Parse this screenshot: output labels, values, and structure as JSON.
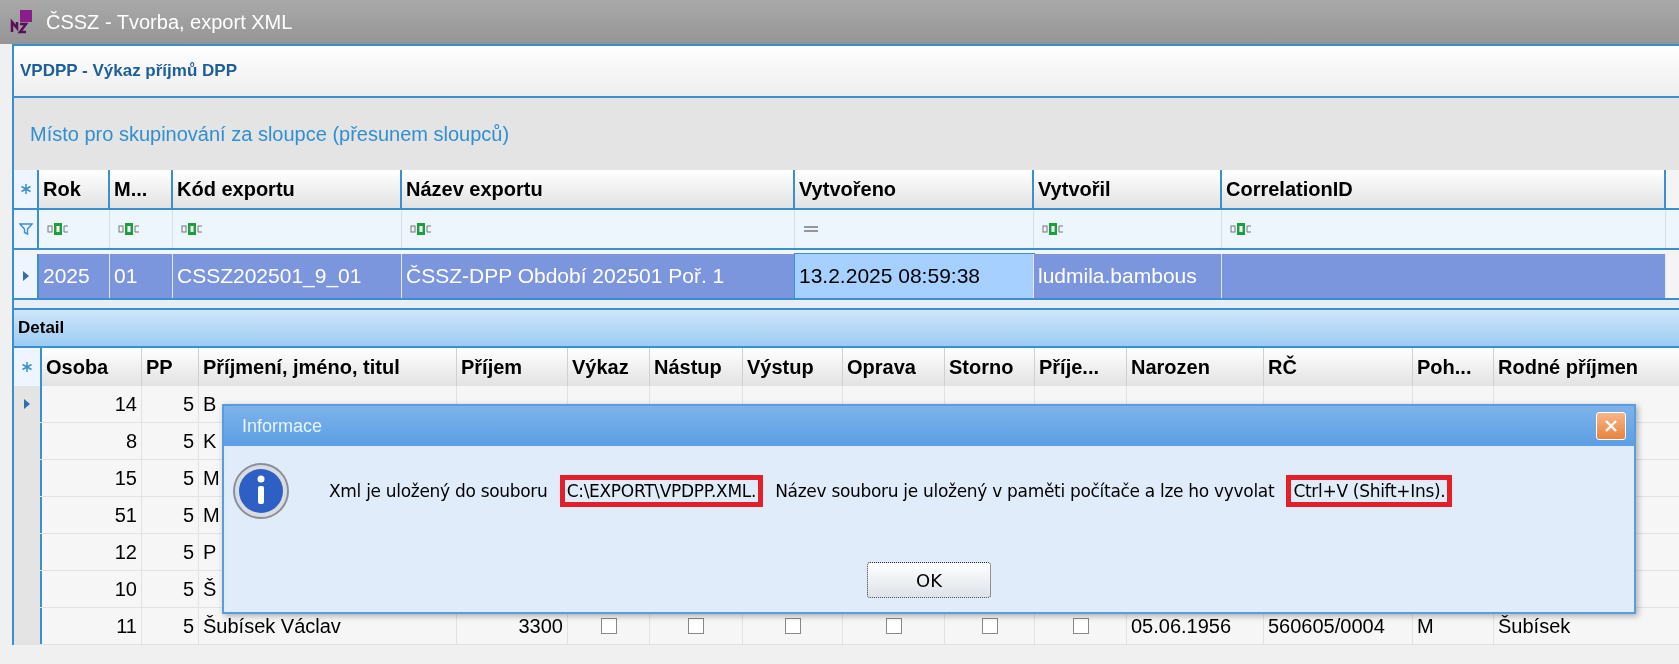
{
  "window": {
    "title": "ČSSZ - Tvorba, export XML"
  },
  "panel_title": "VPDPP - Výkaz příjmů DPP",
  "group_hint": "Místo pro skupinování za sloupce (přesunem sloupců)",
  "top_grid": {
    "columns": [
      {
        "label": "Rok",
        "kind": "text"
      },
      {
        "label": "M...",
        "kind": "text"
      },
      {
        "label": "Kód exportu",
        "kind": "text"
      },
      {
        "label": "Název exportu",
        "kind": "text"
      },
      {
        "label": "Vytvořeno",
        "kind": "equals"
      },
      {
        "label": "Vytvořil",
        "kind": "text"
      },
      {
        "label": "CorrelationID",
        "kind": "text"
      }
    ],
    "rows": [
      {
        "selected": true,
        "current": true,
        "cells": [
          {
            "text": "2025",
            "focused": false
          },
          {
            "text": "01",
            "focused": false
          },
          {
            "text": "CSSZ202501_9_01",
            "focused": false
          },
          {
            "text": "ČSSZ-DPP Období 202501 Poř. 1",
            "focused": false
          },
          {
            "text": "13.2.2025 08:59:38",
            "focused": true
          },
          {
            "text": "ludmila.bambous",
            "focused": false
          },
          {
            "focused": false
          }
        ]
      }
    ]
  },
  "detail": {
    "title": "Detail",
    "columns": [
      {
        "label": "Osoba",
        "kind": "number"
      },
      {
        "label": "PP",
        "kind": "number"
      },
      {
        "label": "Příjmení, jméno, titul",
        "kind": "text"
      },
      {
        "label": "Příjem",
        "kind": "number"
      },
      {
        "label": "Výkaz",
        "kind": "check"
      },
      {
        "label": "Nástup",
        "kind": "check"
      },
      {
        "label": "Výstup",
        "kind": "check"
      },
      {
        "label": "Oprava",
        "kind": "check"
      },
      {
        "label": "Storno",
        "kind": "check"
      },
      {
        "label": "Příje...",
        "kind": "check"
      },
      {
        "label": "Narozen",
        "kind": "text"
      },
      {
        "label": "RČ",
        "kind": "text"
      },
      {
        "label": "Poh...",
        "kind": "text"
      },
      {
        "label": "Rodné příjmen",
        "kind": "text"
      }
    ],
    "rows": [
      {
        "current": true,
        "cells": [
          "14",
          "5",
          "B"
        ]
      },
      {
        "current": false,
        "cells": [
          "8",
          "5",
          "K"
        ]
      },
      {
        "current": false,
        "cells": [
          "15",
          "5",
          "M"
        ]
      },
      {
        "current": false,
        "cells": [
          "51",
          "5",
          "M"
        ]
      },
      {
        "current": false,
        "cells": [
          "12",
          "5",
          "P"
        ]
      },
      {
        "current": false,
        "cells": [
          "10",
          "5",
          "Š"
        ]
      },
      {
        "current": false,
        "cells": [
          "11",
          "5",
          "Šubísek Václav",
          "3300",
          false,
          false,
          false,
          false,
          false,
          false,
          "05.06.1956",
          "560605/0004",
          "M",
          "Šubísek"
        ]
      }
    ]
  },
  "dialog": {
    "title": "Informace",
    "message": [
      {
        "text": "Xml je uložený do souboru ",
        "highlighted": false
      },
      {
        "text": "C:\\EXPORT\\VPDPP.XML.",
        "highlighted": true
      },
      {
        "text": " Název souboru je uložený v paměti počítače a lze ho vyvolat ",
        "highlighted": false
      },
      {
        "text": "Ctrl+V (Shift+Ins).",
        "highlighted": true
      }
    ],
    "button": "OK"
  }
}
